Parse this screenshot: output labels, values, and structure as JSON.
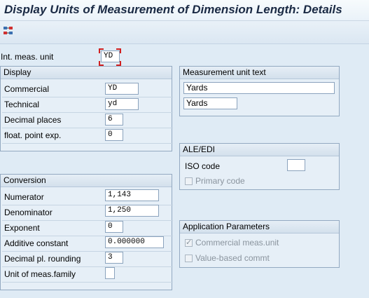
{
  "window": {
    "title": "Display Units of Measurement of Dimension Length: Details"
  },
  "toolbar": {
    "icon": "transport-icon"
  },
  "header": {
    "int_label": "Int. meas. unit",
    "int_value": "YD"
  },
  "display": {
    "title": "Display",
    "commercial_label": "Commercial",
    "commercial_value": "YD",
    "technical_label": "Technical",
    "technical_value": "yd",
    "decimal_label": "Decimal places",
    "decimal_value": "6",
    "float_label": "float. point exp.",
    "float_value": "0"
  },
  "mut": {
    "title": "Measurement unit text",
    "long_text": "Yards",
    "short_text": "Yards"
  },
  "ale": {
    "title": "ALE/EDI",
    "iso_label": "ISO code",
    "iso_value": "",
    "primary_label": "Primary code"
  },
  "conversion": {
    "title": "Conversion",
    "numerator_label": "Numerator",
    "numerator_value": "1,143",
    "denominator_label": "Denominator",
    "denominator_value": "1,250",
    "exponent_label": "Exponent",
    "exponent_value": "0",
    "additive_label": "Additive constant",
    "additive_value": "0.000000",
    "rounding_label": "Decimal pl. rounding",
    "rounding_value": "3",
    "family_label": "Unit of meas.family",
    "family_value": ""
  },
  "app": {
    "title": "Application Parameters",
    "commercial_label": "Commercial meas.unit",
    "commercial_checked": true,
    "value_label": "Value-based commt",
    "value_checked": false
  }
}
